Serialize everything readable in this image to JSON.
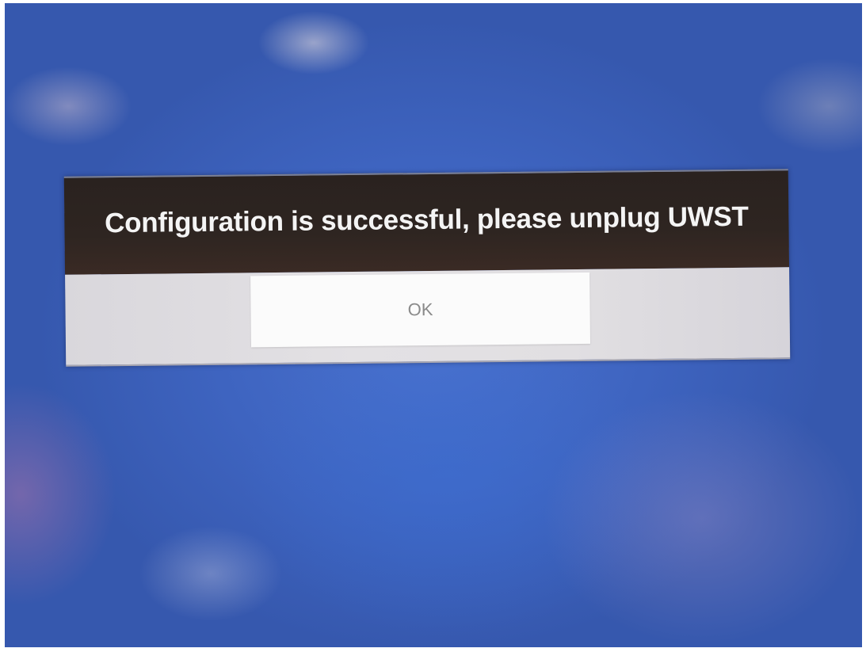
{
  "dialog": {
    "message": "Configuration is successful, please unplug UWST",
    "ok_label": "OK"
  },
  "colors": {
    "background": "#4a72cf",
    "dialog_header": "#2e2521",
    "dialog_body": "#e1dfe2",
    "button": "#fbfbfb",
    "title_text": "#f4f4f4",
    "button_text": "#8a8a8a"
  }
}
